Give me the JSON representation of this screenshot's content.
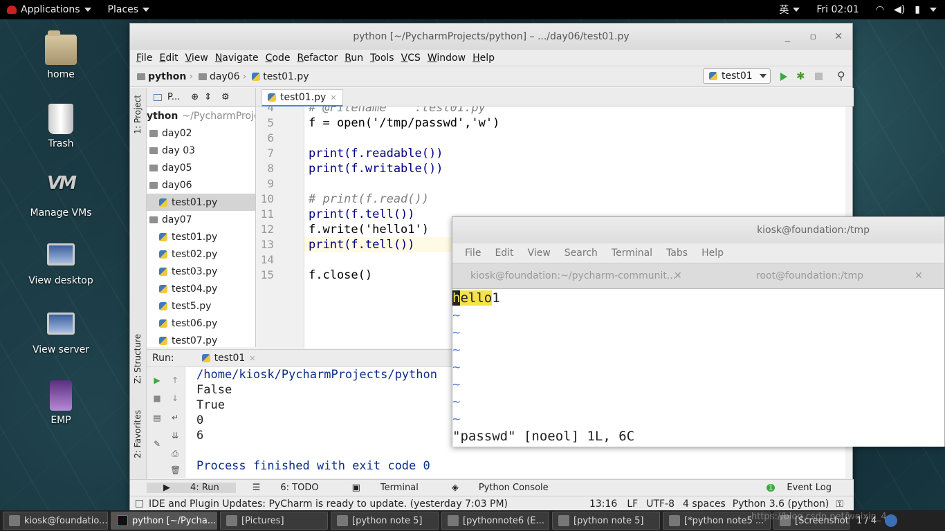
{
  "topbar": {
    "applications": "Applications",
    "places": "Places",
    "input_method": "英",
    "clock": "Fri 02:01"
  },
  "desktop_icons": [
    {
      "label": "home",
      "icon": "home-folder-icon"
    },
    {
      "label": "Trash",
      "icon": "trash-icon"
    },
    {
      "label": "Manage VMs",
      "icon": "vm-icon"
    },
    {
      "label": "View desktop",
      "icon": "monitor-icon"
    },
    {
      "label": "View server",
      "icon": "monitor-icon"
    },
    {
      "label": "EMP",
      "icon": "emp-icon"
    }
  ],
  "pycharm": {
    "title": "python [~/PycharmProjects/python] – .../day06/test01.py",
    "menu": [
      "File",
      "Edit",
      "View",
      "Navigate",
      "Code",
      "Refactor",
      "Run",
      "Tools",
      "VCS",
      "Window",
      "Help"
    ],
    "breadcrumb": [
      "python",
      "day06",
      "test01.py"
    ],
    "run_config": "test01",
    "project_panel": {
      "header": "P...",
      "root": "ython",
      "root_path": "~/PycharmProjec",
      "items": [
        {
          "label": "day02",
          "type": "folder"
        },
        {
          "label": "day 03",
          "type": "folder"
        },
        {
          "label": "day05",
          "type": "folder"
        },
        {
          "label": "day06",
          "type": "folder"
        },
        {
          "label": "test01.py",
          "type": "file"
        },
        {
          "label": "day07",
          "type": "folder"
        },
        {
          "label": "test01.py",
          "type": "file"
        },
        {
          "label": "test02.py",
          "type": "file"
        },
        {
          "label": "test03.py",
          "type": "file"
        },
        {
          "label": "test04.py",
          "type": "file"
        },
        {
          "label": "test5.py",
          "type": "file"
        },
        {
          "label": "test06.py",
          "type": "file"
        },
        {
          "label": "test07.py",
          "type": "file"
        }
      ]
    },
    "side_tabs": {
      "project": "1: Project",
      "structure": "Z: Structure",
      "favorites": "2: Favorites"
    },
    "editor_tab": "test01.py",
    "code_lines": [
      {
        "n": "4",
        "text": "# @Filename    :test01.py"
      },
      {
        "n": "5",
        "text": "f = open('/tmp/passwd','w')"
      },
      {
        "n": "6",
        "text": ""
      },
      {
        "n": "7",
        "text": "print(f.readable())"
      },
      {
        "n": "8",
        "text": "print(f.writable())"
      },
      {
        "n": "9",
        "text": ""
      },
      {
        "n": "10",
        "text": "# print(f.read())"
      },
      {
        "n": "11",
        "text": "print(f.tell())"
      },
      {
        "n": "12",
        "text": "f.write('hello1')"
      },
      {
        "n": "13",
        "text": "print(f.tell())"
      },
      {
        "n": "14",
        "text": ""
      },
      {
        "n": "15",
        "text": "f.close()"
      }
    ],
    "run_panel": {
      "label": "Run:",
      "tab": "test01",
      "output": [
        "/home/kiosk/PycharmProjects/python",
        "False",
        "True",
        "0",
        "6"
      ],
      "finished": "Process finished with exit code 0"
    },
    "bottom_tools": [
      "4: Run",
      "6: TODO",
      "Terminal",
      "Python Console"
    ],
    "event_log": "Event Log",
    "event_count": "1",
    "status": {
      "message": "IDE and Plugin Updates: PyCharm is ready to update. (yesterday 7:03 PM)",
      "position": "13:16",
      "line_sep": "LF",
      "encoding": "UTF-8",
      "indent": "4 spaces",
      "interpreter": "Python 3.6 (python)"
    }
  },
  "terminal": {
    "title": "kiosk@foundation:/tmp",
    "menu": [
      "File",
      "Edit",
      "View",
      "Search",
      "Terminal",
      "Tabs",
      "Help"
    ],
    "tabs": [
      "kiosk@foundation:~/pycharm-communit...",
      "root@foundation:/tmp"
    ],
    "content_first": "h",
    "content_hl": "ello",
    "content_rest": "1",
    "tildes": [
      "~",
      "~",
      "~",
      "~",
      "~",
      "~",
      "~"
    ],
    "status": "\"passwd\" [noeol] 1L, 6C"
  },
  "taskbar": [
    {
      "label": "kiosk@foundatio...",
      "active": false
    },
    {
      "label": "python [~/Pycha...",
      "active": true
    },
    {
      "label": "[Pictures]",
      "active": false
    },
    {
      "label": "[python note 5]",
      "active": false
    },
    {
      "label": "[pythonnote6 (E...",
      "active": false
    },
    {
      "label": "[python note 5]",
      "active": false
    },
    {
      "label": "[*python note5 ...",
      "active": false
    },
    {
      "label": "[Screenshot fro...",
      "active": false
    }
  ],
  "taskbar_pager": "1 / 4",
  "watermark": "https://blog.csdn.net/weixin_4"
}
